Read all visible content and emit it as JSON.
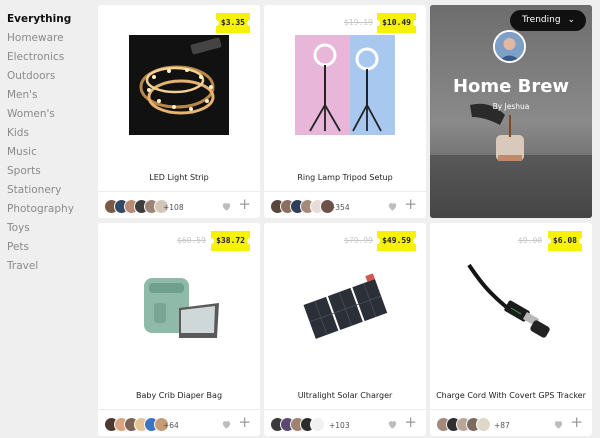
{
  "categories": [
    "Everything",
    "Homeware",
    "Electronics",
    "Outdoors",
    "Men's",
    "Women's",
    "Kids",
    "Music",
    "Sports",
    "Stationery",
    "Photography",
    "Toys",
    "Pets",
    "Travel"
  ],
  "products": [
    {
      "title": "LED Light Strip",
      "price": "$3.35",
      "old_price": "",
      "count": "+108"
    },
    {
      "title": "Ring Lamp Tripod Setup",
      "price": "$10.49",
      "old_price": "$19.19",
      "count": "+354"
    },
    {
      "title": "Baby Crib Diaper Bag",
      "price": "$38.72",
      "old_price": "$60.59",
      "count": "+64"
    },
    {
      "title": "Ultralight Solar Charger",
      "price": "$49.59",
      "old_price": "$79.99",
      "count": "+103"
    },
    {
      "title": "Charge Cord With Covert GPS Tracker",
      "price": "$6.08",
      "old_price": "$9.00",
      "count": "+87"
    }
  ],
  "trending": {
    "button_label": "Trending",
    "title": "Home Brew",
    "author": "By Jeshua"
  },
  "colors": {
    "price_tag": "#f7f203",
    "background": "#efefef",
    "active_category": "#111111",
    "inactive_category": "#8a8a8a"
  }
}
